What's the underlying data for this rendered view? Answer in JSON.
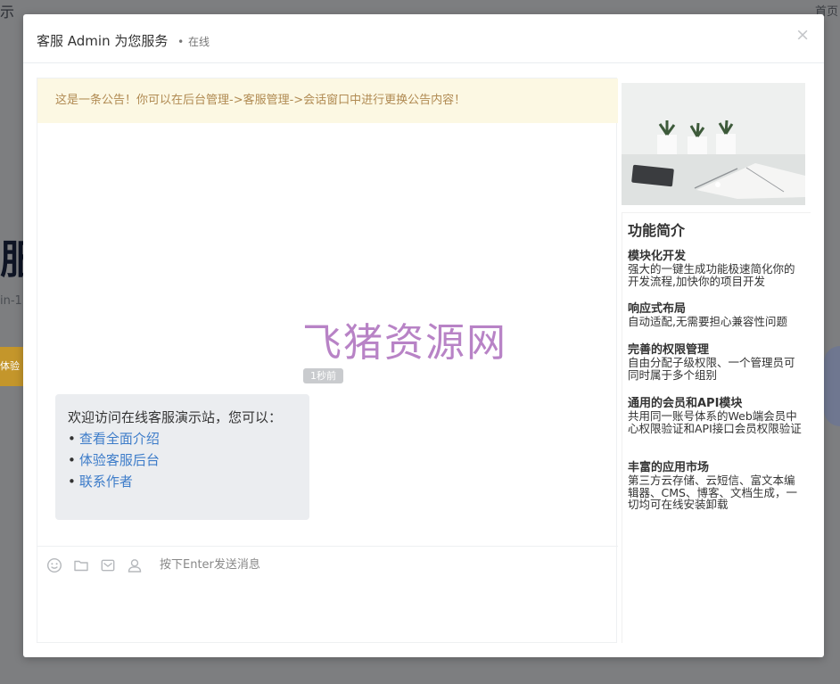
{
  "background": {
    "top_left_fragment": "示",
    "top_right_fragment": "首页",
    "big_fragment": "服系",
    "sub_fragment": "in-1",
    "button_fragment": "体验"
  },
  "modal": {
    "title": "客服 Admin 为您服务",
    "status_dot": "•",
    "status": "在线",
    "close_label": "×"
  },
  "chat": {
    "notice": "这是一条公告！你可以在后台管理->客服管理->会话窗口中进行更换公告内容！",
    "watermark": "飞猪资源网",
    "time_badge": "1秒前",
    "message": {
      "intro": "欢迎访问在线客服演示站，您可以：",
      "bullet": "•",
      "links": [
        "查看全面介绍",
        "体验客服后台",
        "联系作者"
      ]
    },
    "input_placeholder": "按下Enter发送消息",
    "tools": [
      "smile-icon",
      "folder-icon",
      "envelope-icon",
      "user-icon"
    ]
  },
  "sidebar": {
    "title": "功能简介",
    "features": [
      {
        "name": "模块化开发",
        "desc": "强大的一键生成功能极速简化你的开发流程,加快你的项目开发"
      },
      {
        "name": "响应式布局",
        "desc": "自动适配,无需要担心兼容性问题"
      },
      {
        "name": "完善的权限管理",
        "desc": "自由分配子级权限、一个管理员可同时属于多个组别"
      },
      {
        "name": "通用的会员和API模块",
        "desc": "共用同一账号体系的Web端会员中心权限验证和API接口会员权限验证"
      },
      {
        "name": "丰富的应用市场",
        "desc": "第三方云存储、云短信、富文本编辑器、CMS、博客、文档生成，一切均可在线安装卸载"
      }
    ]
  },
  "colors": {
    "notice_bg": "#fcf8e3",
    "notice_text": "#b08a52",
    "link": "#3d7cc9",
    "watermark": "#b883c6",
    "overlay": "#7d7e80"
  }
}
